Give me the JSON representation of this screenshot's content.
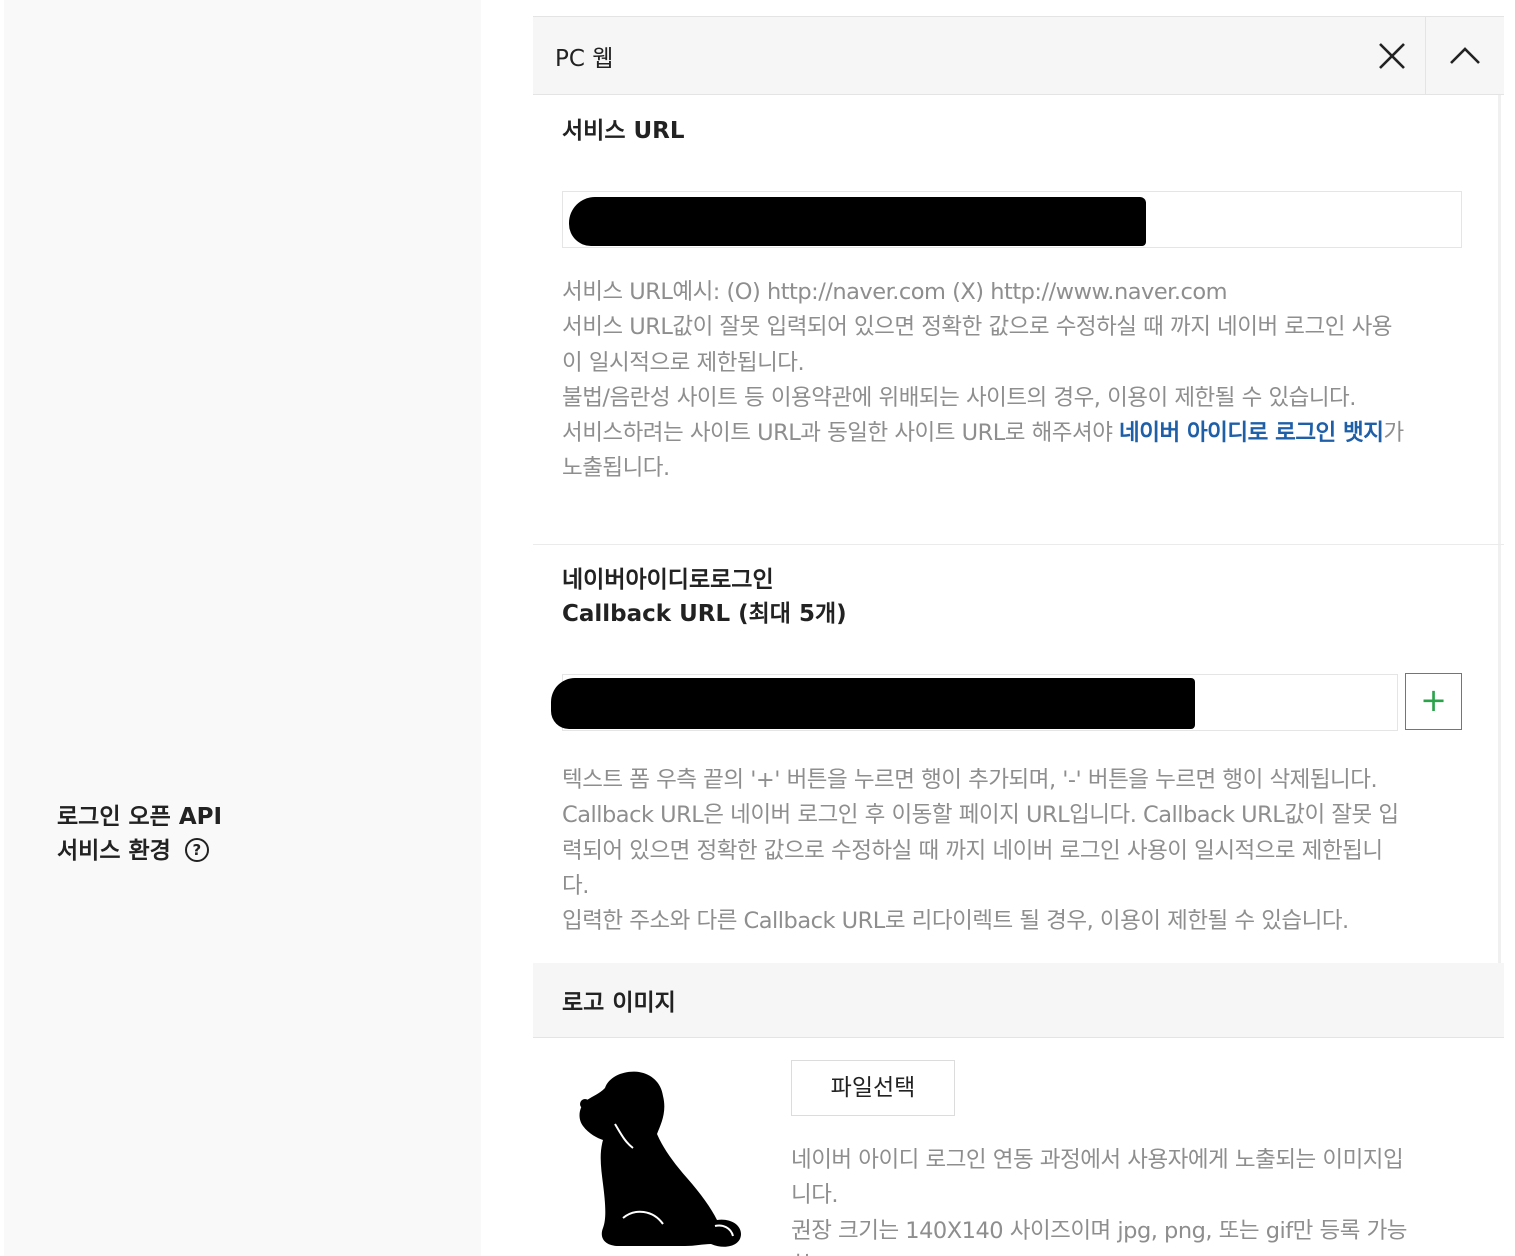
{
  "section": {
    "label_line1": "로그인 오픈 API",
    "label_line2": "서비스 환경",
    "help_icon": "?"
  },
  "panel": {
    "title": "PC 웹",
    "close_icon": "close-icon",
    "collapse_icon": "chevron-up-icon"
  },
  "service_url": {
    "title": "서비스 URL",
    "value": "",
    "help_lines": [
      "서비스 URL예시: (O) http://naver.com (X) http://www.naver.com",
      "서비스 URL값이 잘못 입력되어 있으면 정확한 값으로 수정하실 때 까지 네이버 로그인 사용",
      "이 일시적으로 제한됩니다.",
      "불법/음란성 사이트 등 이용약관에 위배되는 사이트의 경우, 이용이 제한될 수 있습니다."
    ],
    "badge_prefix": "서비스하려는 사이트 URL과 동일한 사이트 URL로 해주셔야 ",
    "badge_link": "네이버 아이디로 로그인 뱃지",
    "badge_suffix": "가",
    "badge_last": "노출됩니다."
  },
  "callback": {
    "title_line1": "네이버아이디로로그인",
    "title_line2": "Callback URL (최대 5개)",
    "value": "",
    "add_label": "+",
    "help_lines": [
      "텍스트 폼 우측 끝의 '+' 버튼을 누르면 행이 추가되며, '-' 버튼을 누르면 행이 삭제됩니다.",
      "Callback URL은 네이버 로그인 후 이동할 페이지 URL입니다. Callback URL값이 잘못 입",
      "력되어 있으면 정확한 값으로 수정하실 때 까지 네이버 로그인 사용이 일시적으로 제한됩니",
      "다.",
      "입력한 주소와 다른 Callback URL로 리다이렉트 될 경우, 이용이 제한될 수 있습니다."
    ]
  },
  "logo": {
    "title": "로고 이미지",
    "file_button": "파일선택",
    "image_icon": "dog-silhouette-icon",
    "help_lines": [
      "네이버 아이디 로그인 연동 과정에서 사용자에게 노출되는 이미지입",
      "니다.",
      "권장 크기는 140X140 사이즈이며 jpg, png, 또는 gif만 등록 가능",
      "합"
    ]
  }
}
